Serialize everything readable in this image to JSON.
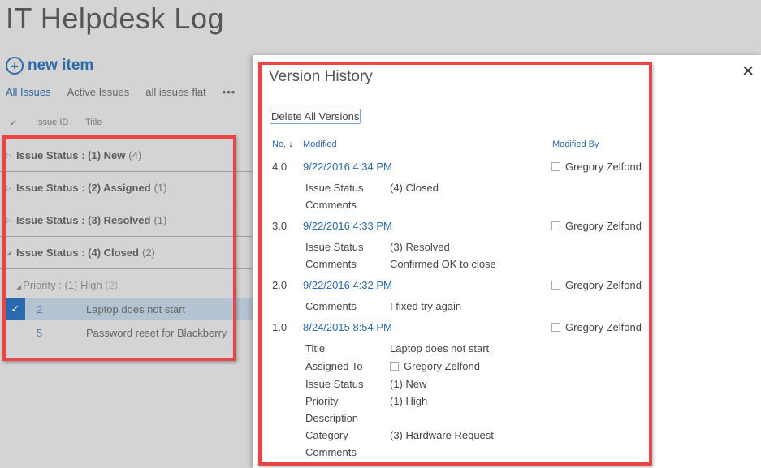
{
  "page": {
    "title": "IT Helpdesk Log",
    "new_item_label": "new item",
    "views": [
      "All Issues",
      "Active Issues",
      "all issues flat",
      "•••"
    ],
    "columns": [
      "Issue ID",
      "Title"
    ]
  },
  "groups": [
    {
      "label": "Issue Status : ",
      "value": "(1) New",
      "count": "(4)",
      "expanded": false
    },
    {
      "label": "Issue Status : ",
      "value": "(2) Assigned",
      "count": "(1)",
      "expanded": false
    },
    {
      "label": "Issue Status : ",
      "value": "(3) Resolved",
      "count": "(1)",
      "expanded": false
    },
    {
      "label": "Issue Status : ",
      "value": "(4) Closed",
      "count": "(2)",
      "expanded": true
    }
  ],
  "subgroup": {
    "label": "Priority : (1) High",
    "count": "(2)"
  },
  "rows": [
    {
      "id": "2",
      "title": "Laptop does not start",
      "selected": true
    },
    {
      "id": "5",
      "title": "Password reset for Blackberry",
      "selected": false
    }
  ],
  "dialog": {
    "title": "Version History",
    "delete_label": "Delete All Versions",
    "headers": {
      "no": "No.",
      "sort_icon": "↓",
      "modified": "Modified",
      "modified_by": "Modified By"
    },
    "versions": [
      {
        "no": "4.0",
        "date": "9/22/2016 4:34 PM",
        "by": "Gregory Zelfond",
        "fields": [
          {
            "name": "Issue Status",
            "value": "(4) Closed"
          },
          {
            "name": "Comments",
            "value": ""
          }
        ]
      },
      {
        "no": "3.0",
        "date": "9/22/2016 4:33 PM",
        "by": "Gregory Zelfond",
        "fields": [
          {
            "name": "Issue Status",
            "value": "(3) Resolved"
          },
          {
            "name": "Comments",
            "value": "Confirmed OK to close"
          }
        ]
      },
      {
        "no": "2.0",
        "date": "9/22/2016 4:32 PM",
        "by": "Gregory Zelfond",
        "fields": [
          {
            "name": "Comments",
            "value": "I fixed try again"
          }
        ]
      },
      {
        "no": "1.0",
        "date": "8/24/2015 8:54 PM",
        "by": "Gregory Zelfond",
        "fields": [
          {
            "name": "Title",
            "value": "Laptop does not start"
          },
          {
            "name": "Assigned To",
            "value": "Gregory Zelfond"
          },
          {
            "name": "Issue Status",
            "value": "(1) New"
          },
          {
            "name": "Priority",
            "value": "(1) High"
          },
          {
            "name": "Description",
            "value": ""
          },
          {
            "name": "Category",
            "value": "(3) Hardware Request"
          },
          {
            "name": "Comments",
            "value": ""
          }
        ]
      }
    ]
  },
  "colors": {
    "accent": "#2e6aa6",
    "highlight": "#e94545",
    "selected_row": "#b3c3d1"
  }
}
